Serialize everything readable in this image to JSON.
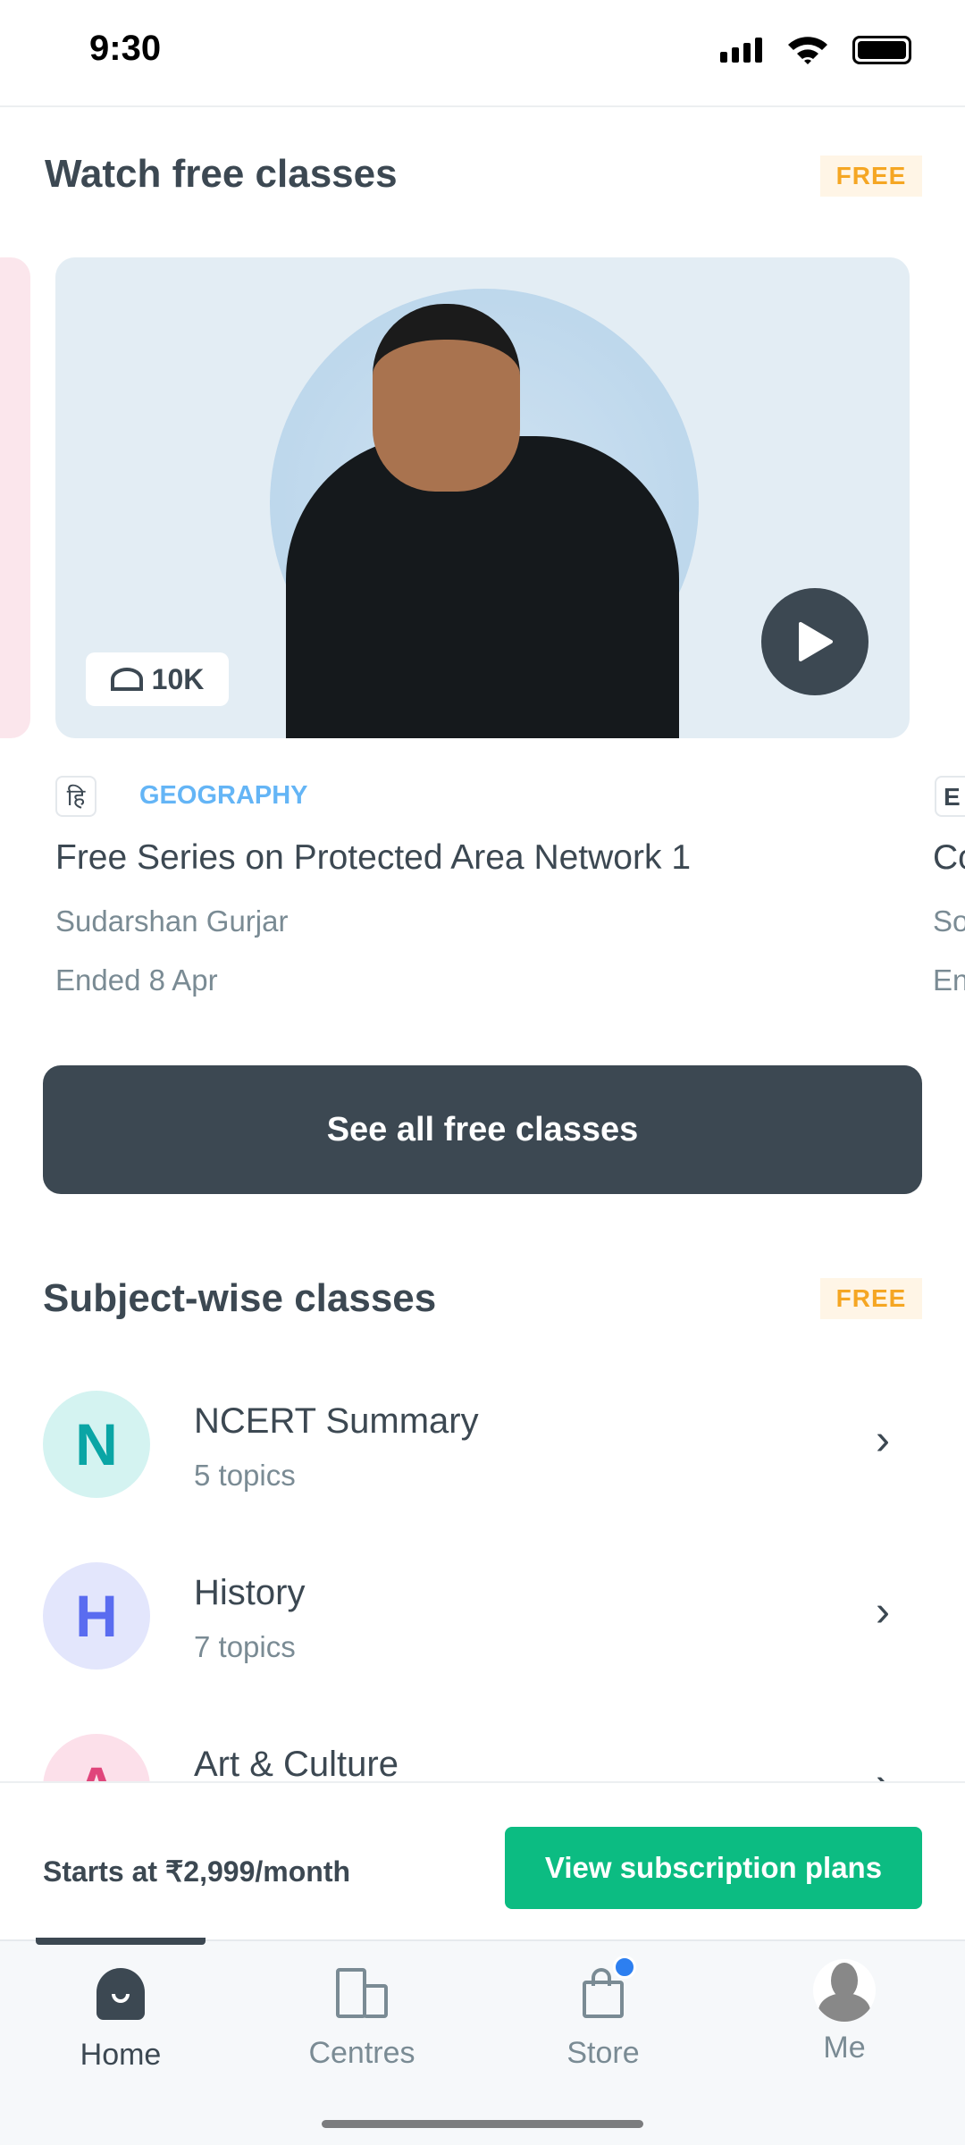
{
  "status_bar": {
    "time": "9:30"
  },
  "free_classes": {
    "heading": "Watch free classes",
    "badge": "FREE",
    "card": {
      "views": "10K",
      "language": "हि",
      "subject": "GEOGRAPHY",
      "title": "Free Series on Protected Area Network 1",
      "educator": "Sudarshan Gurjar",
      "status": "Ended 8 Apr"
    },
    "next_card": {
      "language": "E",
      "title": "Co",
      "educator": "So",
      "status": "En"
    },
    "see_all": "See all free classes"
  },
  "subject_wise": {
    "heading": "Subject-wise classes",
    "badge": "FREE",
    "items": [
      {
        "letter": "N",
        "title": "NCERT Summary",
        "subtitle": "5 topics",
        "color": "#0aa5a5",
        "bg": "#d4f3f1"
      },
      {
        "letter": "H",
        "title": "History",
        "subtitle": "7 topics",
        "color": "#5a6cf0",
        "bg": "#e3e6fc"
      },
      {
        "letter": "A",
        "title": "Art & Culture",
        "subtitle": "",
        "color": "#e0457b",
        "bg": "#fce0ea"
      }
    ]
  },
  "subscription": {
    "price_text": "Starts at ₹2,999/month",
    "button": "View subscription plans"
  },
  "tab_bar": {
    "tabs": [
      {
        "label": "Home",
        "active": true
      },
      {
        "label": "Centres"
      },
      {
        "label": "Store",
        "badge_dot": true
      },
      {
        "label": "Me"
      }
    ]
  },
  "colors": {
    "primary": "#3c4852",
    "accent_green": "#0cbc82",
    "free_badge": "#f5a623",
    "subject": "#64b5f6"
  }
}
